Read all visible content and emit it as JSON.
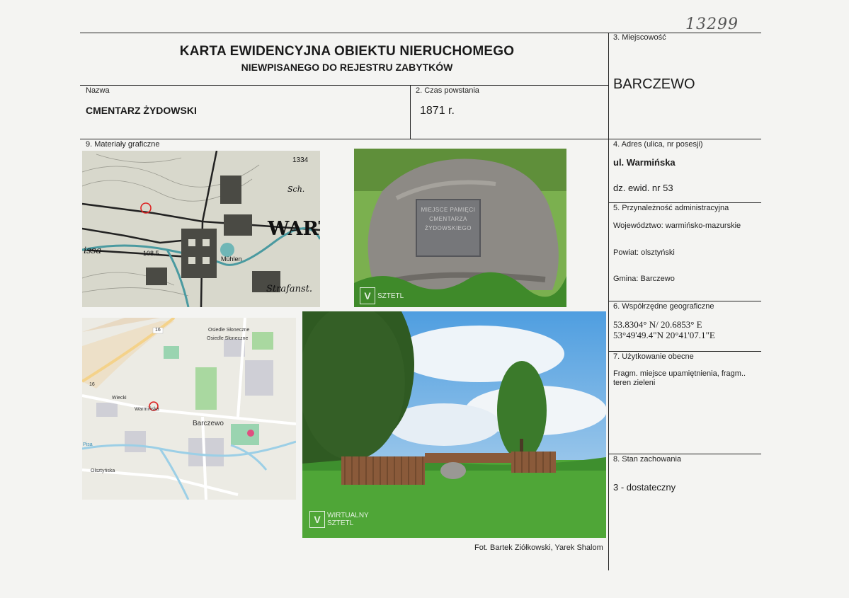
{
  "card_number": "13299",
  "header": {
    "title_line1": "KARTA EWIDENCYJNA OBIEKTU NIERUCHOMEGO",
    "title_line2": "NIEWPISANEGO DO REJESTRU ZABYTKÓW"
  },
  "fields": {
    "nazwa_label": "Nazwa",
    "nazwa_value": "CMENTARZ ŻYDOWSKI",
    "czas_label": "2. Czas powstania",
    "czas_value": "1871 r.",
    "miejscowosc_label": "3. Miejscowość",
    "miejscowosc_value": "BARCZEWO",
    "adres_label": "4. Adres (ulica, nr posesji)",
    "adres_street": "ul. Warmińska",
    "adres_plot": "dz. ewid. nr 53",
    "przynaleznosc_label": "5. Przynależność administracyjna",
    "wojewodztwo": "Województwo: warmińsko-mazurskie",
    "powiat": "Powiat: olsztyński",
    "gmina": "Gmina: Barczewo",
    "wspolrzedne_label": "6. Współrzędne geograficzne",
    "coords_decimal": "53.8304° N/ 20.6853° E",
    "coords_dms": "53°49'49.4\"N 20°41'07.1\"E",
    "uzytkowanie_label": "7. Użytkowanie obecne",
    "uzytkowanie_line1": "Fragm. miejsce upamiętnienia, fragm..",
    "uzytkowanie_line2": "teren zieleni",
    "stan_label": "8. Stan zachowania",
    "stan_value": "3 - dostateczny",
    "materialy_label": "9. Materiały graficzne"
  },
  "old_map_labels": {
    "town": "WART",
    "river": "Mühlen",
    "spot": "Strafanst.",
    "number": "1334",
    "elev": "108.5",
    "left_word": "issa",
    "sch": "Sch."
  },
  "new_map_labels": {
    "town": "Barczewo",
    "street": "Warmińska",
    "road": "16",
    "district": "Osiedle Słoneczne",
    "district2": "Osiedle Słoneczne",
    "street2": "Olsztyńska",
    "street3": "Wiecki",
    "river": "Pisa"
  },
  "watermark": {
    "line1": "WIRTUALNY",
    "line2": "SZTETL"
  },
  "stone_plaque_text": "MIEJSCE PAMIĘCI CMENTARZA ŻYDOWSKIEGO",
  "photo_credit": "Fot. Bartek Ziółkowski, Yarek Shalom"
}
